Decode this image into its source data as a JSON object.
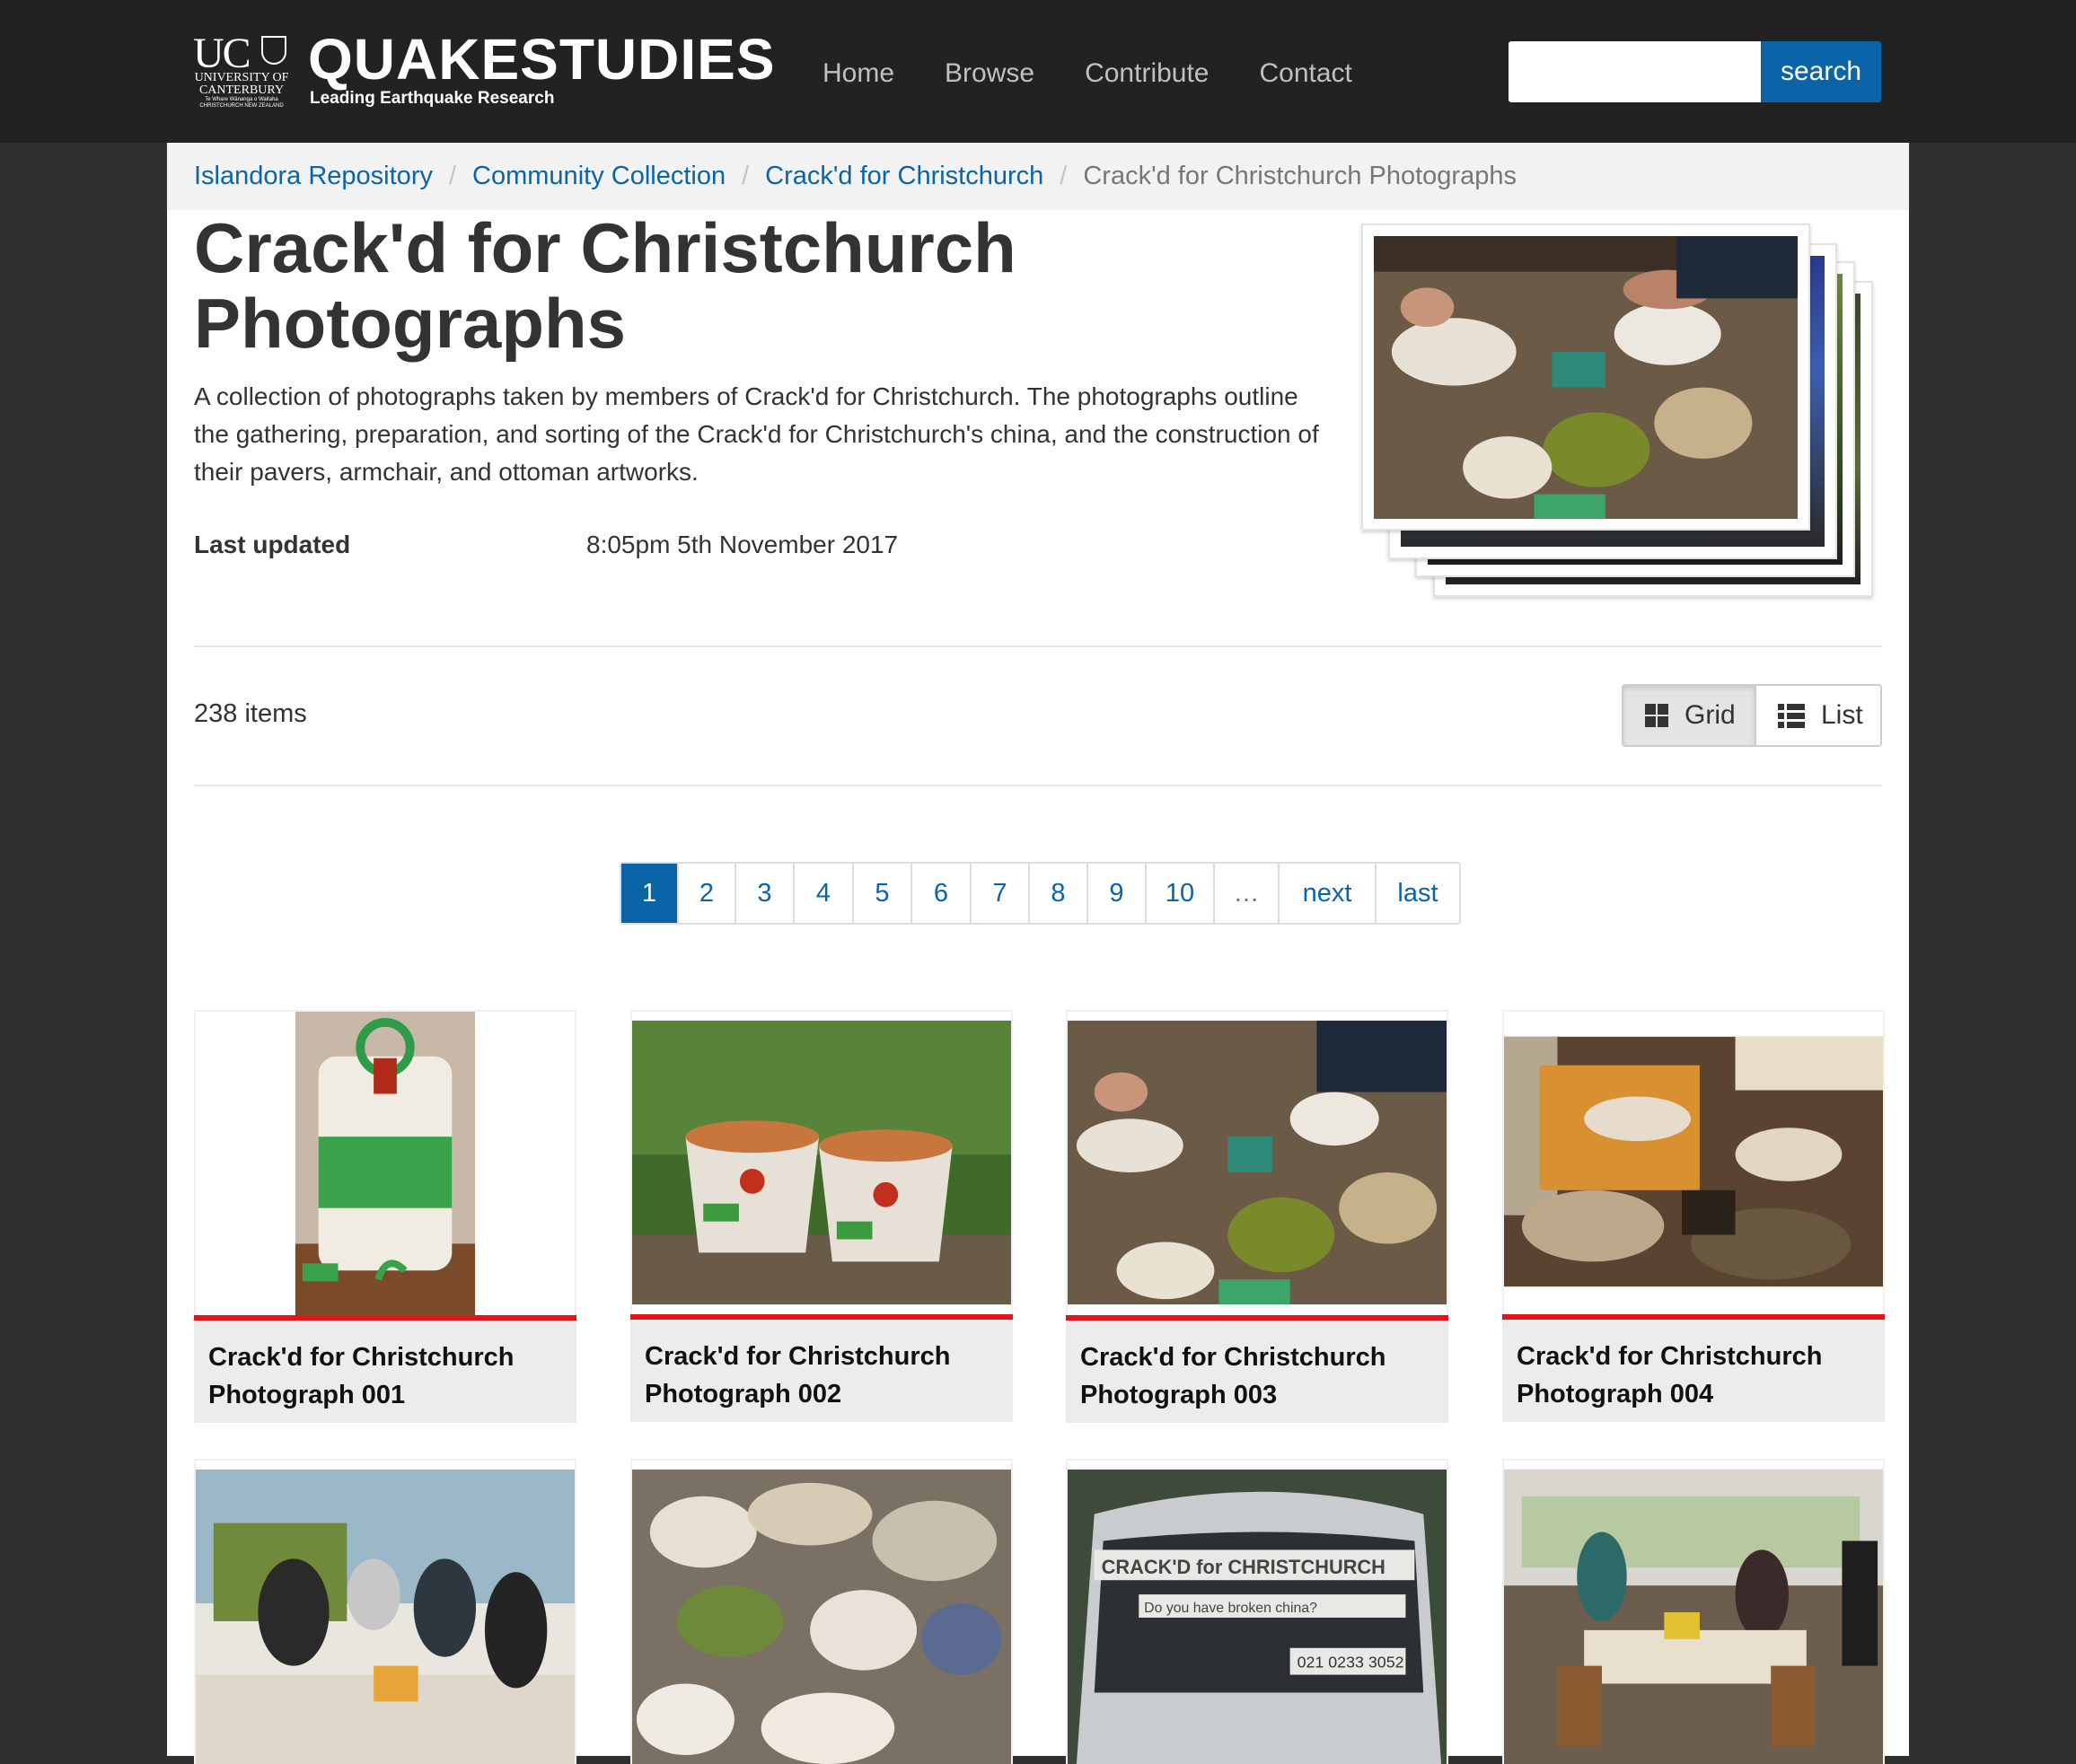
{
  "header": {
    "uc_letters": "UC",
    "uc_university": "UNIVERSITY OF CANTERBURY",
    "uc_motto": "Te Whare Wānanga o Waitaha CHRISTCHURCH NEW ZEALAND",
    "brand": "QUAKESTUDIES",
    "tagline": "Leading Earthquake Research",
    "nav": [
      "Home",
      "Browse",
      "Contribute",
      "Contact"
    ],
    "search_value": "",
    "search_label": "search"
  },
  "breadcrumb": {
    "items": [
      "Islandora Repository",
      "Community Collection",
      "Crack'd for Christchurch"
    ],
    "current": "Crack'd for Christchurch Photographs"
  },
  "collection": {
    "title": "Crack'd for Christchurch Photographs",
    "description": "A collection of photographs taken by members of Crack'd for Christchurch. The photographs outline the gathering, preparation, and sorting of the Crack'd for Christchurch's china, and the construction of their pavers, armchair, and ottoman artworks.",
    "last_updated_label": "Last updated",
    "last_updated_value": "8:05pm 5th November 2017"
  },
  "listing": {
    "count": "238 items",
    "view_grid": "Grid",
    "view_list": "List",
    "active_view": "Grid"
  },
  "pager": {
    "pages": [
      "1",
      "2",
      "3",
      "4",
      "5",
      "6",
      "7",
      "8",
      "9",
      "10"
    ],
    "current": "1",
    "ellipsis": "…",
    "next": "next",
    "last": "last"
  },
  "items": [
    {
      "title": "Crack'd for Christchurch Photograph 001"
    },
    {
      "title": "Crack'd for Christchurch Photograph 002"
    },
    {
      "title": "Crack'd for Christchurch Photograph 003"
    },
    {
      "title": "Crack'd for Christchurch Photograph 004"
    }
  ],
  "photo_text": {
    "car_sign_title": "CRACK'D for CHRISTCHURCH",
    "car_sign_question": "Do you have broken china?",
    "car_sign_phone": "021 0233 3052"
  },
  "colors": {
    "header_bg": "#222222",
    "page_bg": "#303030",
    "link": "#0b64a8",
    "accent_red": "#e3151a",
    "caption_bg": "#ececec"
  }
}
